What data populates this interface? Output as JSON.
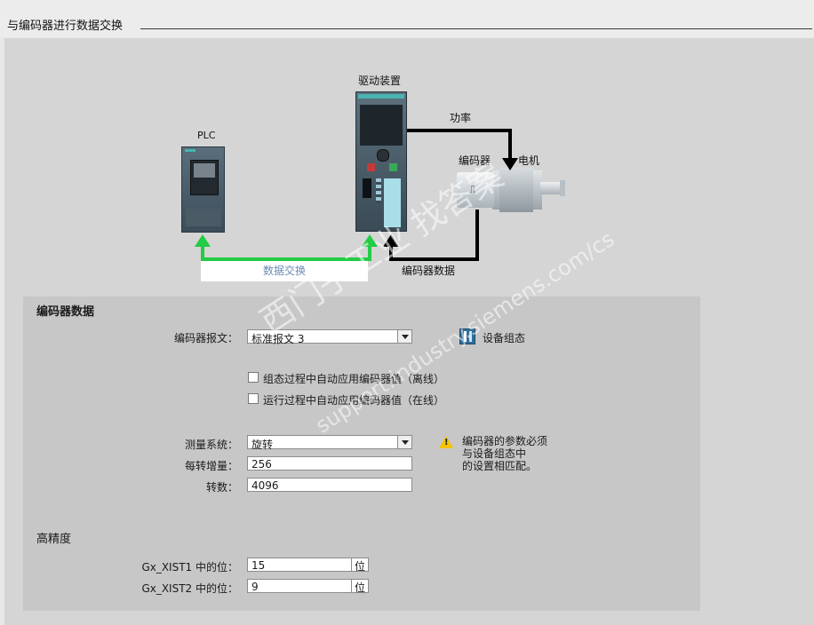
{
  "section": {
    "title": "与编码器进行数据交换"
  },
  "diagram": {
    "plc_label": "PLC",
    "drive_label": "驱动装置",
    "power_label": "功率",
    "encoder_label": "编码器",
    "motor_label": "电机",
    "encoder_data_label": "编码器数据",
    "data_exchange_label": "数据交换",
    "encoder_symbol": "⎍"
  },
  "watermark": {
    "line1": "西门子工业 找答案",
    "line2": "support.industry.siemens.com/cs"
  },
  "encoder_data": {
    "title": "编码器数据",
    "telegram_label": "编码器报文：",
    "telegram_value": "标准报文 3",
    "device_config_label": "设备组态",
    "checkbox_offline": "组态过程中自动应用编码器值（离线）",
    "checkbox_online": "运行过程中自动应用编码器值（在线）",
    "measuring_system_label": "测量系统：",
    "measuring_system_value": "旋转",
    "increments_label": "每转增量：",
    "increments_value": "256",
    "revolutions_label": "转数：",
    "revolutions_value": "4096",
    "warning_text": "编码器的参数必须\n与设备组态中\n的设置相匹配。"
  },
  "precision": {
    "title": "高精度",
    "xist1_label": "Gx_XIST1 中的位：",
    "xist1_value": "15",
    "xist2_label": "Gx_XIST2 中的位：",
    "xist2_value": "9",
    "unit": "位"
  },
  "colors": {
    "green_arrow": "#22cc44",
    "black_arrow": "#000000",
    "panel_bg": "#c7c7c7"
  }
}
